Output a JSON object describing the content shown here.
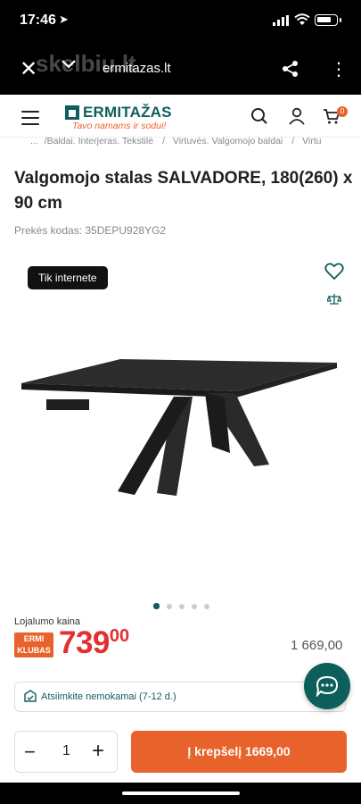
{
  "status_bar": {
    "time": "17:46",
    "location_glyph": "➤"
  },
  "browser": {
    "watermark": "skelbiu.lt",
    "url": "ermitazas.lt"
  },
  "site": {
    "logo_name": "ERMITAŽAS",
    "logo_tagline": "Tavo namams ir sodui!",
    "cart_count": "0"
  },
  "breadcrumb": [
    "...",
    "/Baldai. Interjeras. Tekstilė",
    "Virtuvės. Valgomojo baldai",
    "Virtu"
  ],
  "product": {
    "title": "Valgomojo stalas SALVADORE, 180(260) x 90 cm",
    "sku": "Prekės kodas: 35DEPU928YG2",
    "badge": "Tik internete",
    "image_count": 5,
    "active_image": 0
  },
  "pricing": {
    "loyalty_label": "Lojalumo kaina",
    "club_badge_line1": "ERMI",
    "club_badge_line2": "KLUBAS",
    "price_int": "739",
    "price_dec": "00",
    "regular_price": "1 669,00"
  },
  "pickup": {
    "text": "Atsiimkite nemokamai (7-12 d.)"
  },
  "cart": {
    "quantity": "1",
    "minus": "−",
    "plus": "+",
    "add_label": "Į krepšelį  1669,00"
  },
  "colors": {
    "brand_teal": "#0d5f5b",
    "brand_orange": "#e8632b",
    "price_red": "#e32f2f"
  }
}
